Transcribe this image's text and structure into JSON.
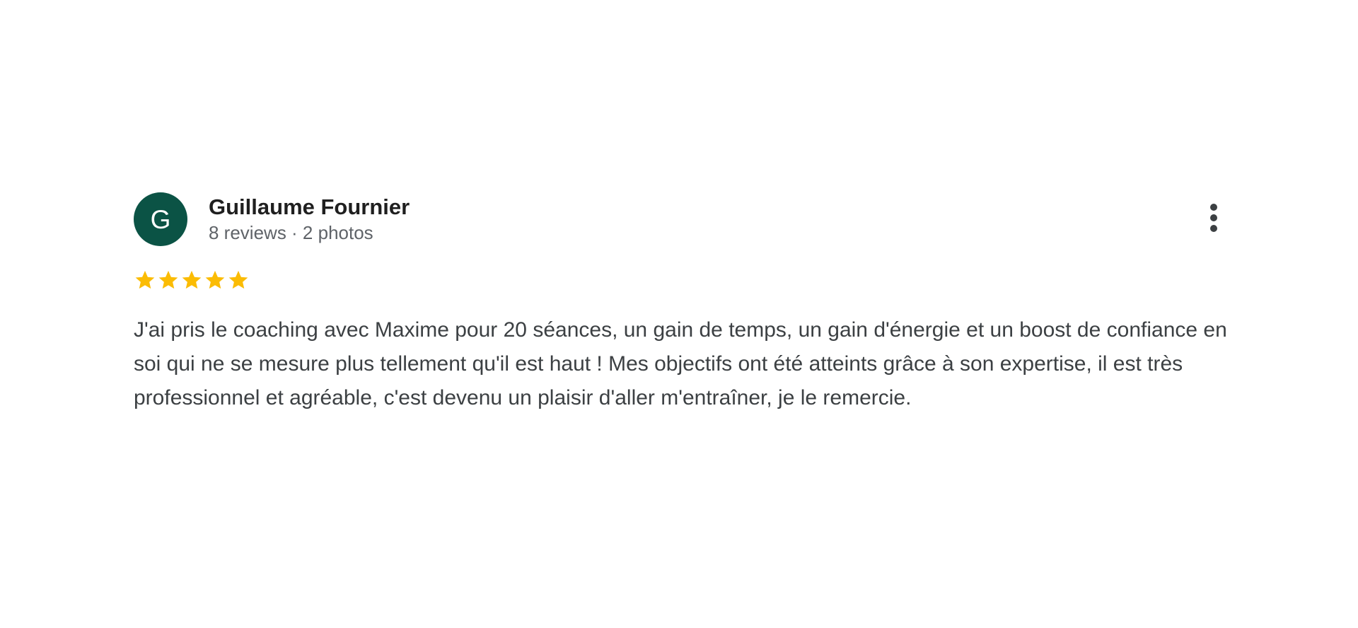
{
  "review": {
    "author": {
      "initial": "G",
      "name": "Guillaume Fournier",
      "meta": "8 reviews · 2 photos",
      "avatar_color": "#0b5345"
    },
    "rating": 5,
    "rating_max": 5,
    "star_color": "#fbbc04",
    "text": "J'ai pris le coaching avec Maxime pour 20 séances, un gain de temps, un gain d'énergie et un boost de confiance en soi qui ne se mesure plus tellement qu'il est haut ! Mes objectifs ont été atteints grâce à son expertise, il est très professionnel et agréable, c'est devenu un plaisir d'aller m'entraîner, je le remercie.",
    "menu_icon": "more-vert-icon"
  }
}
